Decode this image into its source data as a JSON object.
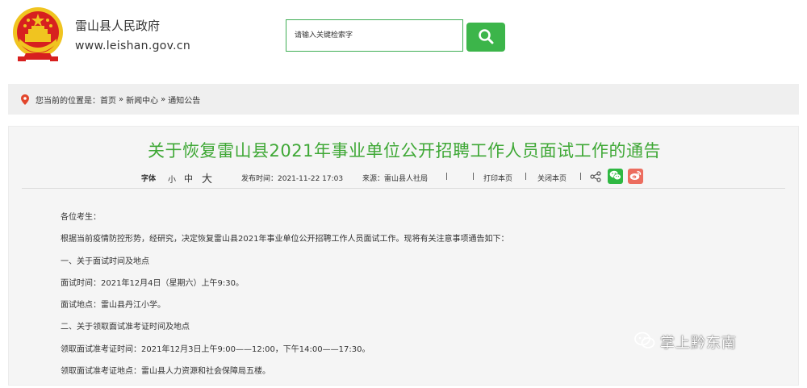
{
  "header": {
    "site_name": "雷山县人民政府",
    "site_url": "www.leishan.gov.cn",
    "search_placeholder": "请输入关键检索字"
  },
  "breadcrumb": {
    "prefix": "您当前的位置是：",
    "items": [
      "首页",
      "新闻中心",
      "通知公告"
    ],
    "separator": "»"
  },
  "article": {
    "title": "关于恢复雷山县2021年事业单位公开招聘工作人员面试工作的通告",
    "meta": {
      "font_size_label": "字体",
      "font_small": "小",
      "font_medium": "中",
      "font_large": "大",
      "publish_time": "发布时间：2021-11-22 17:03",
      "source": "来源：雷山县人社局",
      "separator": "|",
      "print": "打印本页",
      "close": "关闭本页"
    },
    "paragraphs": [
      "各位考生：",
      "根据当前疫情防控形势，经研究，决定恢复雷山县2021年事业单位公开招聘工作人员面试工作。现将有关注意事项通告如下：",
      "一、关于面试时间及地点",
      "面试时间：2021年12月4日（星期六）上午9:30。",
      "面试地点：雷山县丹江小学。",
      "二、关于领取面试准考证时间及地点",
      "领取面试准考证时间：2021年12月3日上午9:00——12:00，下午14:00——17:30。",
      "领取面试准考证地点：雷山县人力资源和社会保障局五楼。"
    ]
  },
  "watermark": {
    "text": "掌上黔东南"
  },
  "colors": {
    "accent_green": "#3cb54a",
    "title_green": "#3fa836",
    "emblem_red": "#d7201f",
    "emblem_gold": "#f0c420",
    "wechat_green": "#2fb842",
    "weibo_red": "#ec6d5f",
    "pin_red": "#e2462c"
  },
  "icons": [
    "national-emblem-logo",
    "search-icon",
    "location-pin-icon",
    "share-icon",
    "wechat-icon",
    "weibo-icon",
    "wechat-channel-icon"
  ]
}
